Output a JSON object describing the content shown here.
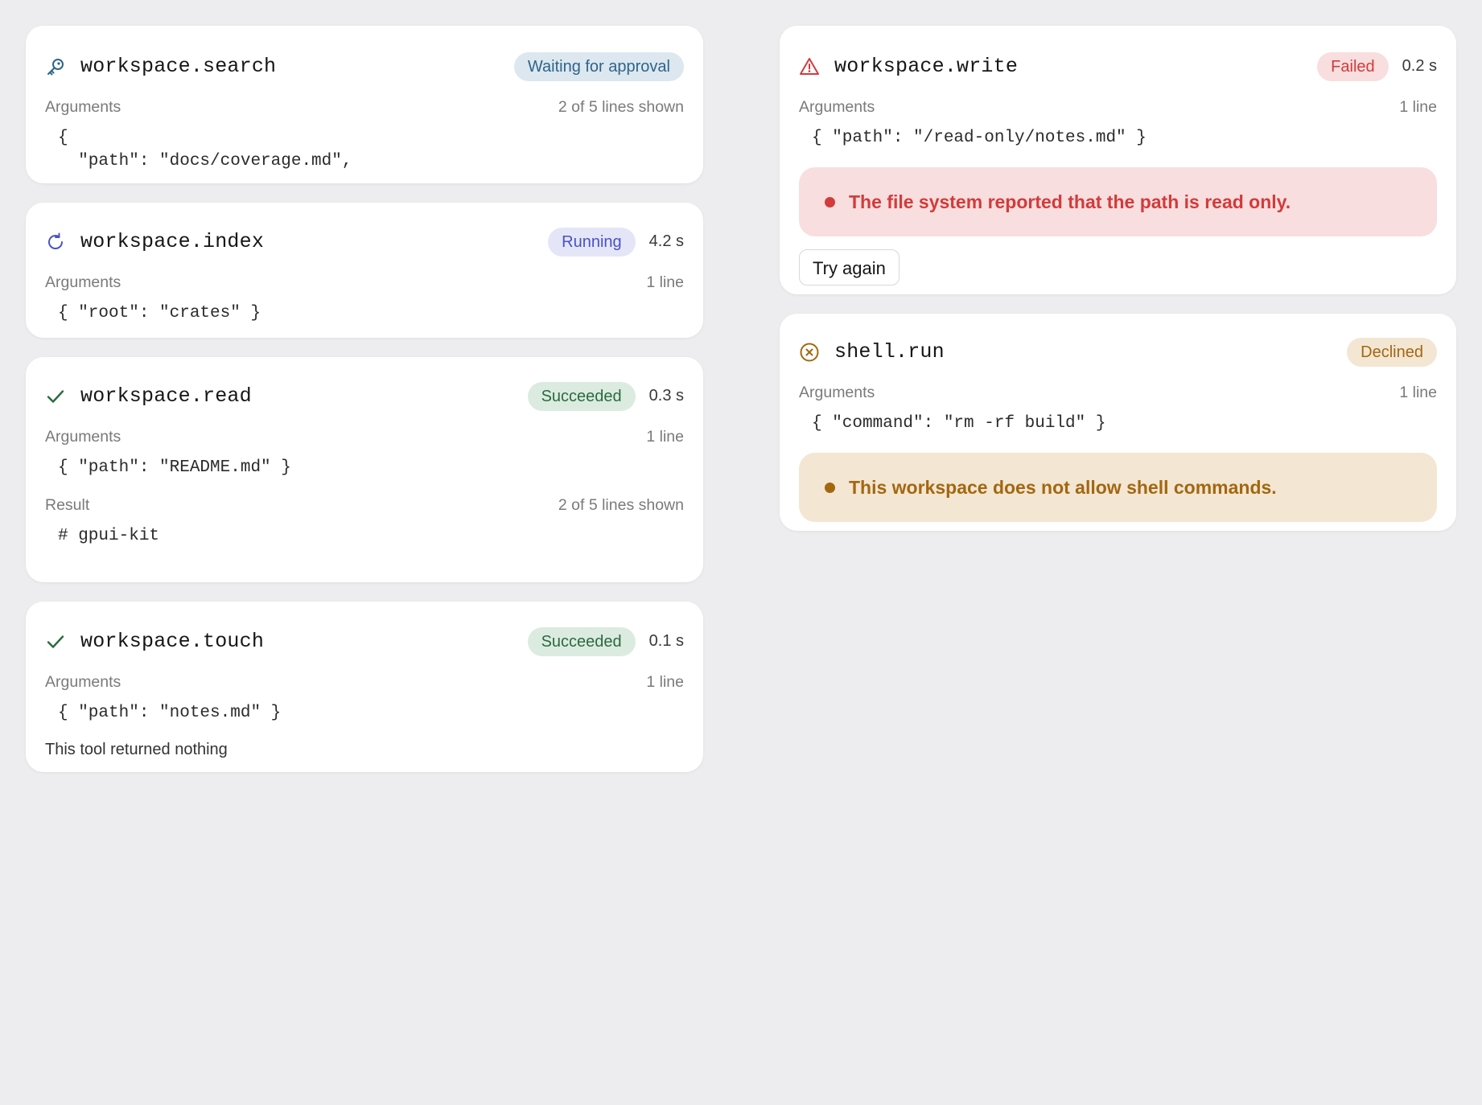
{
  "cards": {
    "search": {
      "name": "workspace.search",
      "status": "Waiting for approval",
      "args_label": "Arguments",
      "args_info": "2 of 5 lines shown",
      "args_code": "{\n  \"path\": \"docs/coverage.md\","
    },
    "index": {
      "name": "workspace.index",
      "status": "Running",
      "duration": "4.2 s",
      "args_label": "Arguments",
      "args_info": "1 line",
      "args_code": "{ \"root\": \"crates\" }"
    },
    "read": {
      "name": "workspace.read",
      "status": "Succeeded",
      "duration": "0.3 s",
      "args_label": "Arguments",
      "args_info": "1 line",
      "args_code": "{ \"path\": \"README.md\" }",
      "result_label": "Result",
      "result_info": "2 of 5 lines shown",
      "result_code": "# gpui-kit\n"
    },
    "touch": {
      "name": "workspace.touch",
      "status": "Succeeded",
      "duration": "0.1 s",
      "args_label": "Arguments",
      "args_info": "1 line",
      "args_code": "{ \"path\": \"notes.md\" }",
      "empty_result": "This tool returned nothing"
    },
    "write": {
      "name": "workspace.write",
      "status": "Failed",
      "duration": "0.2 s",
      "args_label": "Arguments",
      "args_info": "1 line",
      "args_code": "{ \"path\": \"/read-only/notes.md\" }",
      "error": "The file system reported that the path is read only.",
      "retry_label": "Try again"
    },
    "shell": {
      "name": "shell.run",
      "status": "Declined",
      "args_label": "Arguments",
      "args_info": "1 line",
      "args_code": "{ \"command\": \"rm -rf build\" }",
      "notice": "This workspace does not allow shell commands."
    }
  },
  "icons": {
    "search": "key-icon",
    "index": "refresh-icon",
    "read": "check-icon",
    "touch": "check-icon",
    "write": "warning-icon",
    "shell": "x-circle-icon"
  },
  "colors": {
    "background": "#ededef",
    "waiting_bg": "#dde7ef",
    "waiting_fg": "#2d6589",
    "running_bg": "#e4e6f7",
    "running_fg": "#4a52c4",
    "success_bg": "#dcebe0",
    "success_fg": "#2a6b3f",
    "failed_bg": "#f8dede",
    "failed_fg": "#d23b3b",
    "declined_bg": "#f3e6d3",
    "declined_fg": "#a36710"
  }
}
